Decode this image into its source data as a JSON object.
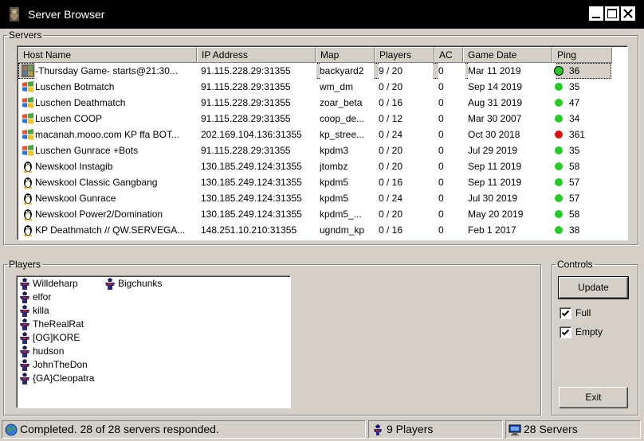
{
  "window": {
    "title": "Server Browser"
  },
  "servers": {
    "group_label": "Servers",
    "columns": [
      "Host Name",
      "IP Address",
      "Map",
      "Players",
      "AC",
      "Game Date",
      "Ping"
    ],
    "rows": [
      {
        "host": "-Thursday Game- starts@21:30...",
        "ip": "91.115.228.29:31355",
        "map": "backyard2",
        "players": "9 / 20",
        "ac": "0",
        "date": "Mar 11 2019",
        "ping": "36",
        "status": "good",
        "os": "windows",
        "selected": true
      },
      {
        "host": "Luschen Botmatch",
        "ip": "91.115.228.29:31355",
        "map": "wm_dm",
        "players": "0 / 20",
        "ac": "0",
        "date": "Sep 14 2019",
        "ping": "35",
        "status": "good",
        "os": "windows"
      },
      {
        "host": "Luschen Deathmatch",
        "ip": "91.115.228.29:31355",
        "map": "zoar_beta",
        "players": "0 / 16",
        "ac": "0",
        "date": "Aug 31 2019",
        "ping": "47",
        "status": "good",
        "os": "windows"
      },
      {
        "host": "Luschen COOP",
        "ip": "91.115.228.29:31355",
        "map": "coop_de...",
        "players": "0 / 12",
        "ac": "0",
        "date": "Mar 30 2007",
        "ping": "34",
        "status": "good",
        "os": "windows"
      },
      {
        "host": "macanah.mooo.com KP ffa BOT...",
        "ip": "202.169.104.136:31355",
        "map": "kp_stree...",
        "players": "0 / 24",
        "ac": "0",
        "date": "Oct 30 2018",
        "ping": "361",
        "status": "bad",
        "os": "windows"
      },
      {
        "host": "Luschen Gunrace +Bots",
        "ip": "91.115.228.29:31355",
        "map": "kpdm3",
        "players": "0 / 20",
        "ac": "0",
        "date": "Jul 29 2019",
        "ping": "35",
        "status": "good",
        "os": "windows"
      },
      {
        "host": "Newskool Instagib",
        "ip": "130.185.249.124:31355",
        "map": "jtombz",
        "players": "0 / 20",
        "ac": "0",
        "date": "Sep 11 2019",
        "ping": "58",
        "status": "good",
        "os": "linux"
      },
      {
        "host": "Newskool Classic Gangbang",
        "ip": "130.185.249.124:31355",
        "map": "kpdm5",
        "players": "0 / 16",
        "ac": "0",
        "date": "Sep 11 2019",
        "ping": "57",
        "status": "good",
        "os": "linux"
      },
      {
        "host": "Newskool Gunrace",
        "ip": "130.185.249.124:31355",
        "map": "kpdm5",
        "players": "0 / 24",
        "ac": "0",
        "date": "Jul 30 2019",
        "ping": "57",
        "status": "good",
        "os": "linux"
      },
      {
        "host": "Newskool Power2/Domination",
        "ip": "130.185.249.124:31355",
        "map": "kpdm5_...",
        "players": "0 / 20",
        "ac": "0",
        "date": "May 20 2019",
        "ping": "58",
        "status": "good",
        "os": "linux"
      },
      {
        "host": "KP Deathmatch // QW.SERVEGA...",
        "ip": "148.251.10.210:31355",
        "map": "ugndm_kp",
        "players": "0 / 16",
        "ac": "0",
        "date": "Feb  1 2017",
        "ping": "38",
        "status": "good",
        "os": "linux"
      }
    ]
  },
  "players": {
    "group_label": "Players",
    "list": [
      {
        "name": "Willdeharp",
        "col": 0
      },
      {
        "name": "Bigchunks",
        "col": 1
      },
      {
        "name": "elfor",
        "col": 0
      },
      {
        "name": "killa",
        "col": 0
      },
      {
        "name": "TheRealRat",
        "col": 0
      },
      {
        "name": "[OG]KORE",
        "col": 0
      },
      {
        "name": "hudson",
        "col": 0
      },
      {
        "name": "JohnTheDon",
        "col": 0
      },
      {
        "name": "{GA}Cleopatra",
        "col": 0
      }
    ]
  },
  "controls": {
    "group_label": "Controls",
    "update_label": "Update",
    "full_label": "Full",
    "full_checked": true,
    "empty_label": "Empty",
    "empty_checked": true,
    "exit_label": "Exit"
  },
  "status": {
    "message": "Completed. 28 of 28 servers responded.",
    "players_count": "9 Players",
    "servers_count": "28 Servers"
  },
  "colors": {
    "ping_good": "#22cc22",
    "ping_bad": "#dd1111",
    "titlebar": "#000000",
    "face": "#d4d0c8"
  }
}
